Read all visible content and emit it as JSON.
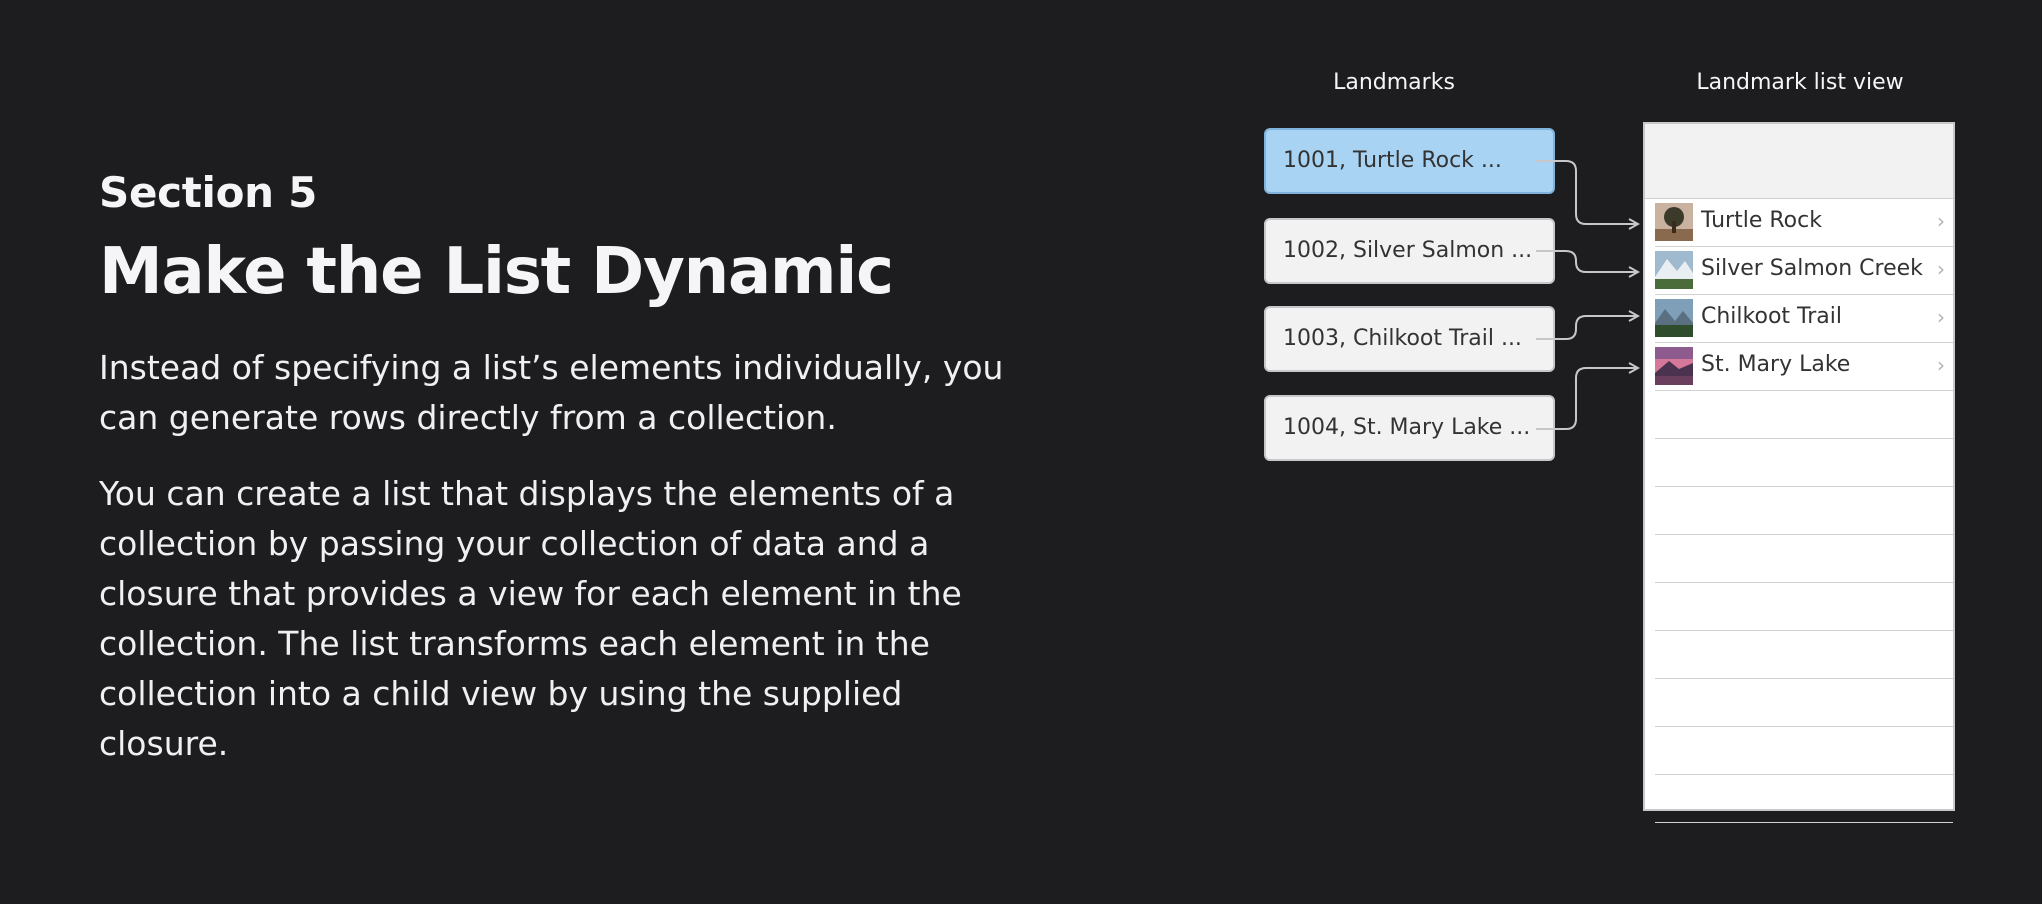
{
  "section": "Section 5",
  "title": "Make the List Dynamic",
  "paragraphs": [
    "Instead of specifying a list’s elements individually, you can generate rows directly from a collection.",
    "You can create a list that displays the elements of a collection by passing your collection of data and a closure that provides a view for each element in the collection. The list transforms each element in the collection into a child view by using the supplied closure."
  ],
  "diagram": {
    "landmarks_label": "Landmarks",
    "listview_label": "Landmark list view",
    "landmarks": [
      {
        "text": "1001, Turtle Rock ...",
        "selected": true
      },
      {
        "text": "1002, Silver Salmon ...",
        "selected": false
      },
      {
        "text": "1003, Chilkoot Trail ...",
        "selected": false
      },
      {
        "text": "1004, St. Mary Lake ...",
        "selected": false
      }
    ],
    "rows": [
      {
        "label": "Turtle Rock",
        "chevron": "›",
        "icon": "turtle-rock-thumbnail-icon"
      },
      {
        "label": "Silver Salmon Creek",
        "chevron": "›",
        "icon": "silver-salmon-creek-thumbnail-icon"
      },
      {
        "label": "Chilkoot Trail",
        "chevron": "›",
        "icon": "chilkoot-trail-thumbnail-icon"
      },
      {
        "label": "St. Mary Lake",
        "chevron": "›",
        "icon": "st-mary-lake-thumbnail-icon"
      }
    ],
    "empty_row_count": 9,
    "colors": {
      "selected_fill": "#a8d3f2",
      "box_fill": "#f2f2f2",
      "connector": "#c7c7c9"
    }
  }
}
